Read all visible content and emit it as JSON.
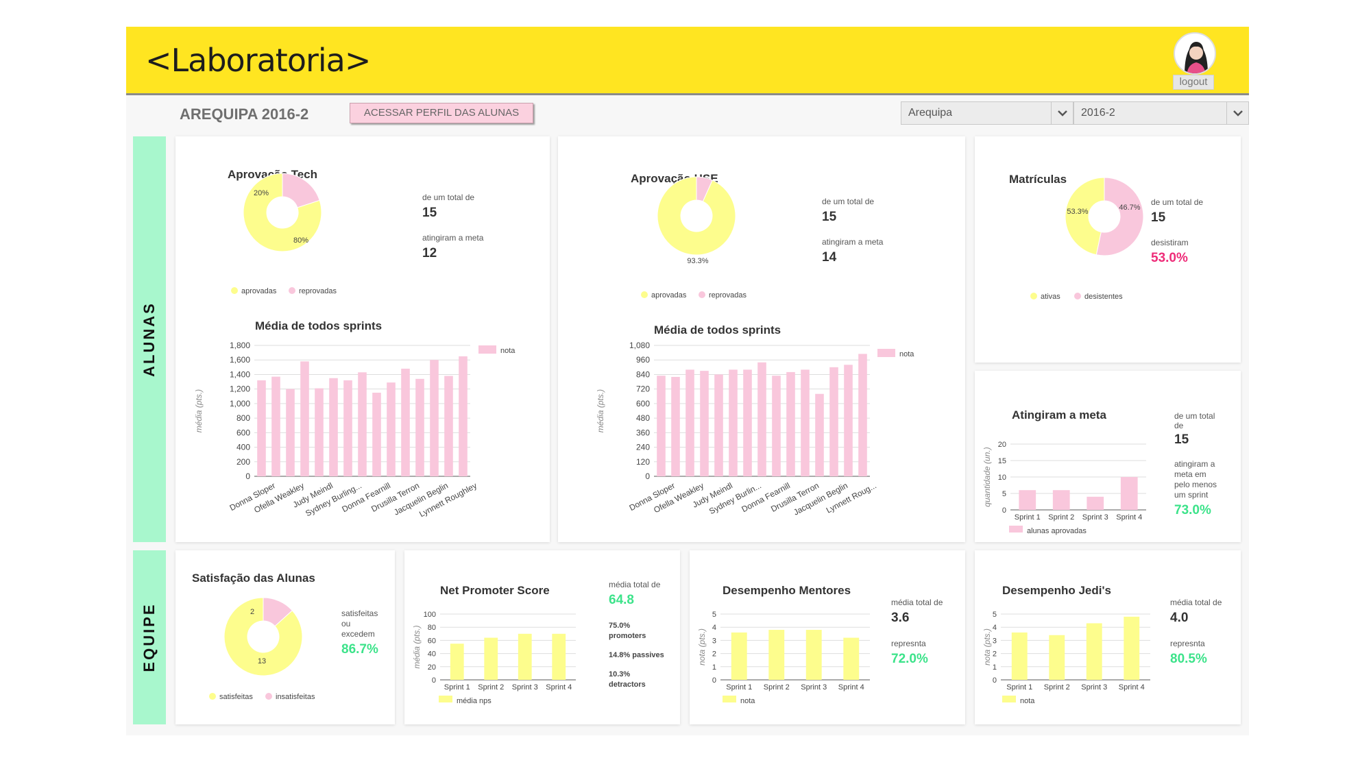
{
  "header": {
    "logo": "<Laboratoria>",
    "logout_label": "logout",
    "avatar_icon": "user-avatar-icon"
  },
  "subbar": {
    "page_title": "AREQUIPA 2016-2",
    "profile_button": "ACESSAR PERFIL DAS ALUNAS",
    "city_select": "Arequipa",
    "period_select": "2016-2"
  },
  "sections": {
    "alunas": "ALUNAS",
    "equipe": "EQUIPE"
  },
  "colors": {
    "yellow": "#ffe521",
    "pie_yellow": "#fdfd8d",
    "pink": "#f9c7dc",
    "green": "#3ce38a",
    "magenta": "#ee2b78",
    "side": "#a8f7cd"
  },
  "cards": {
    "tech": {
      "title": "Aprovação Tech",
      "total_label": "de um total de",
      "total_value": "15",
      "goal_label": "atingiram a meta",
      "goal_value": "12",
      "legend": [
        "aprovadas",
        "reprovadas"
      ]
    },
    "hse": {
      "title": "Aprovação HSE",
      "total_label": "de um total de",
      "total_value": "15",
      "goal_label": "atingiram a meta",
      "goal_value": "14",
      "legend": [
        "aprovadas",
        "reprovadas"
      ]
    },
    "matriculas": {
      "title": "Matrículas",
      "total_label": "de um total de",
      "total_value": "15",
      "dropout_label": "desistiram",
      "dropout_value": "53.0%",
      "legend": [
        "ativas",
        "desistentes"
      ]
    },
    "meta": {
      "title": "Atingiram a meta",
      "total_label_1": "de um total",
      "total_label_2": "de",
      "total_value": "15",
      "desc": [
        "atingiram a",
        "meta em",
        "pelo menos",
        "um sprint"
      ],
      "pct": "73.0%"
    },
    "satisfacao": {
      "title": "Satisfação das Alunas",
      "desc": [
        "satisfeitas",
        "ou",
        "excedem"
      ],
      "pct": "86.7%",
      "legend": [
        "satisfeitas",
        "insatisfeitas"
      ]
    },
    "nps": {
      "title": "Net Promoter Score",
      "avg_label": "média total de",
      "avg_value": "64.8",
      "breakdown": [
        [
          "75.0%",
          "promoters"
        ],
        [
          "14.8% passives"
        ],
        [
          "10.3%",
          "detractors"
        ]
      ]
    },
    "mentores": {
      "title": "Desempenho Mentores",
      "avg_label": "média total de",
      "avg_value": "3.6",
      "rep_label": "represnta",
      "rep_value": "72.0%"
    },
    "jedi": {
      "title": "Desempenho Jedi's",
      "avg_label": "média total de",
      "avg_value": "4.0",
      "rep_label": "represnta",
      "rep_value": "80.5%"
    }
  },
  "chart_data": [
    {
      "id": "tech-pie",
      "type": "pie",
      "title": "Aprovação Tech",
      "labels": [
        "aprovadas",
        "reprovadas"
      ],
      "values": [
        80,
        20
      ],
      "slice_labels": [
        "80%",
        "20%"
      ]
    },
    {
      "id": "tech-bar",
      "type": "bar",
      "title": "Média de todos sprints",
      "ylabel": "média (pts.)",
      "legend": [
        "nota"
      ],
      "ylim": [
        0,
        1800
      ],
      "yticks": [
        "0",
        "200",
        "400",
        "600",
        "800",
        "1,000",
        "1,200",
        "1,400",
        "1,600",
        "1,800"
      ],
      "xlabels": [
        "Donna Sloper",
        "Ofella Weakley",
        "Judy Meindl",
        "Sydney Burling...",
        "Donna Fearnill",
        "Drusilla Terron",
        "Jacquelin Beglin",
        "Lynnett Roughley"
      ],
      "values": [
        1320,
        1370,
        1200,
        1580,
        1210,
        1350,
        1320,
        1430,
        1150,
        1290,
        1480,
        1340,
        1600,
        1380,
        1650
      ]
    },
    {
      "id": "hse-pie",
      "type": "pie",
      "title": "Aprovação HSE",
      "labels": [
        "aprovadas",
        "reprovadas"
      ],
      "values": [
        93.3,
        6.7
      ],
      "slice_labels": [
        "93.3%"
      ]
    },
    {
      "id": "hse-bar",
      "type": "bar",
      "title": "Média de todos sprints",
      "ylabel": "média (pts.)",
      "legend": [
        "nota"
      ],
      "ylim": [
        0,
        1080
      ],
      "yticks": [
        "0",
        "120",
        "240",
        "360",
        "480",
        "600",
        "720",
        "840",
        "960",
        "1,080"
      ],
      "xlabels": [
        "Donna Sloper",
        "Ofella Weakley",
        "Judy Meindl",
        "Sydney Burlin...",
        "Donna Fearnill",
        "Drusilla Terron",
        "Jacquelin Beglin",
        "Lynnett Roug..."
      ],
      "values": [
        830,
        820,
        880,
        870,
        840,
        880,
        880,
        940,
        830,
        860,
        880,
        680,
        900,
        920,
        1010
      ]
    },
    {
      "id": "mat-pie",
      "type": "pie",
      "title": "Matrículas",
      "labels": [
        "ativas",
        "desistentes"
      ],
      "values": [
        46.7,
        53.3
      ],
      "slice_labels": [
        "46.7%",
        "53.3%"
      ]
    },
    {
      "id": "meta-bar",
      "type": "bar",
      "title": "Atingiram a meta",
      "ylabel": "quantidade (un.)",
      "legend": [
        "alunas aprovadas"
      ],
      "ylim": [
        0,
        20
      ],
      "yticks": [
        "0",
        "5",
        "10",
        "15",
        "20"
      ],
      "xlabels": [
        "Sprint 1",
        "Sprint 2",
        "Sprint 3",
        "Sprint 4"
      ],
      "values": [
        6,
        6,
        4,
        10
      ]
    },
    {
      "id": "sat-pie",
      "type": "pie",
      "title": "Satisfação das Alunas",
      "labels": [
        "satisfeitas",
        "insatisfeitas"
      ],
      "values": [
        13,
        2
      ],
      "slice_labels": [
        "13",
        "2"
      ]
    },
    {
      "id": "nps-bar",
      "type": "bar",
      "title": "Net Promoter Score",
      "ylabel": "média (pts.)",
      "legend": [
        "média nps"
      ],
      "ylim": [
        0,
        100
      ],
      "yticks": [
        "0",
        "20",
        "40",
        "60",
        "80",
        "100"
      ],
      "xlabels": [
        "Sprint 1",
        "Sprint 2",
        "Sprint 3",
        "Sprint 4"
      ],
      "values": [
        55,
        64,
        70,
        70
      ]
    },
    {
      "id": "mentores-bar",
      "type": "bar",
      "title": "Desempenho Mentores",
      "ylabel": "nota (pts.)",
      "legend": [
        "nota"
      ],
      "ylim": [
        0,
        5
      ],
      "yticks": [
        "0",
        "1",
        "2",
        "3",
        "4",
        "5"
      ],
      "xlabels": [
        "Sprint 1",
        "Sprint 2",
        "Sprint 3",
        "Sprint 4"
      ],
      "values": [
        3.6,
        3.8,
        3.8,
        3.2
      ]
    },
    {
      "id": "jedi-bar",
      "type": "bar",
      "title": "Desempenho Jedi's",
      "ylabel": "nota (pts.)",
      "legend": [
        "nota"
      ],
      "ylim": [
        0,
        5
      ],
      "yticks": [
        "0",
        "1",
        "2",
        "3",
        "4",
        "5"
      ],
      "xlabels": [
        "Sprint 1",
        "Sprint 2",
        "Sprint 3",
        "Sprint 4"
      ],
      "values": [
        3.6,
        3.4,
        4.3,
        4.8
      ]
    }
  ]
}
